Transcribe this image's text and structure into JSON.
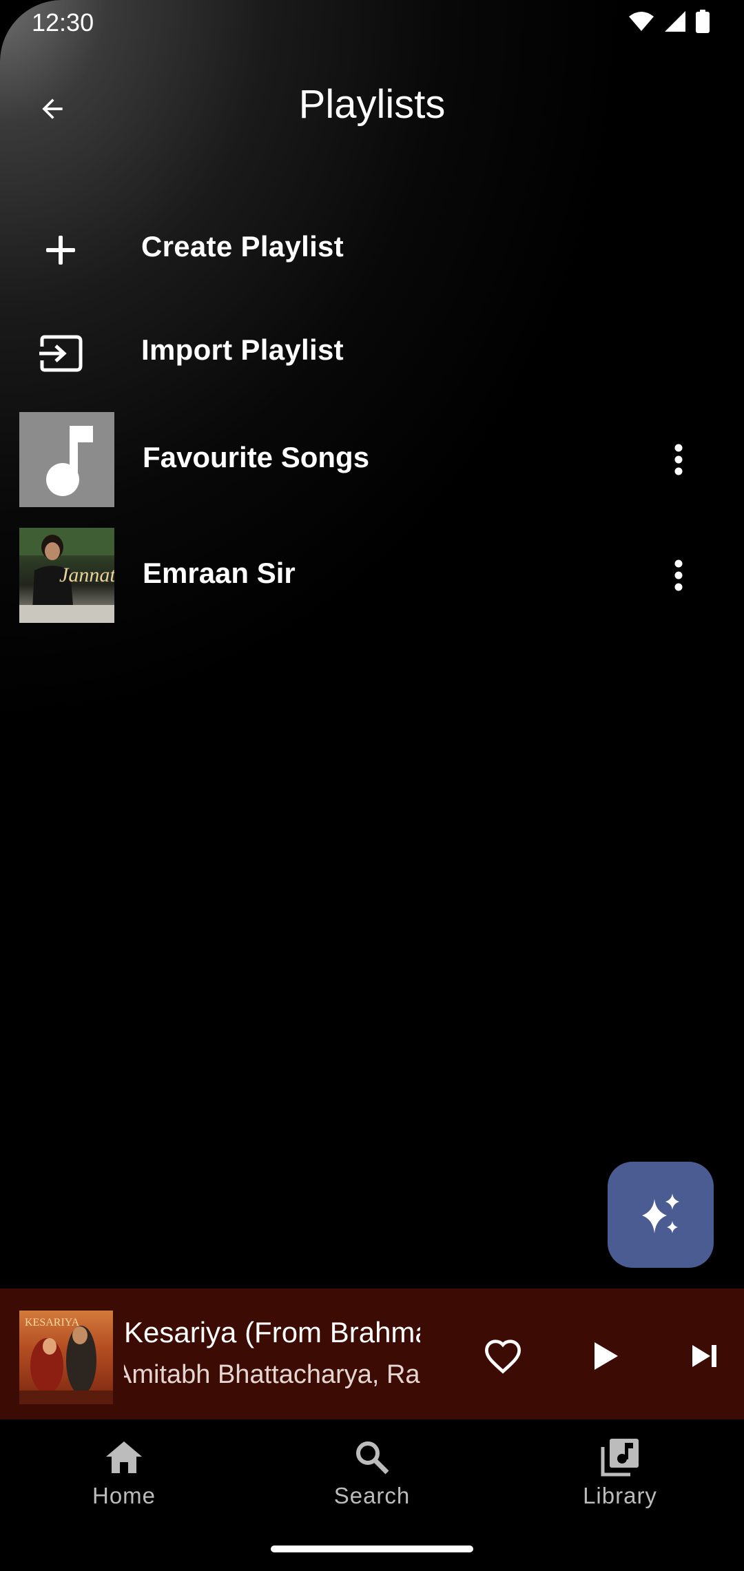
{
  "status_bar": {
    "time": "12:30"
  },
  "header": {
    "title": "Playlists"
  },
  "actions": [
    {
      "label": "Create Playlist",
      "icon": "plus-icon"
    },
    {
      "label": "Import Playlist",
      "icon": "import-icon"
    }
  ],
  "playlists": [
    {
      "title": "Favourite Songs",
      "thumb": "music-note-icon"
    },
    {
      "title": "Emraan Sir",
      "thumb": "album-art",
      "art_text": "Jannat"
    }
  ],
  "fab": {
    "icon": "sparkles-icon",
    "color": "#4b5c93"
  },
  "mini_player": {
    "title": "Kesariya (From Brahmastra)",
    "artist": "Amitabh Bhattacharya, Ranbir Kapoor",
    "art_text": "KESARIYA",
    "background": "#3c0c04"
  },
  "nav": [
    {
      "label": "Home",
      "icon": "home-icon"
    },
    {
      "label": "Search",
      "icon": "search-icon"
    },
    {
      "label": "Library",
      "icon": "library-icon"
    }
  ]
}
